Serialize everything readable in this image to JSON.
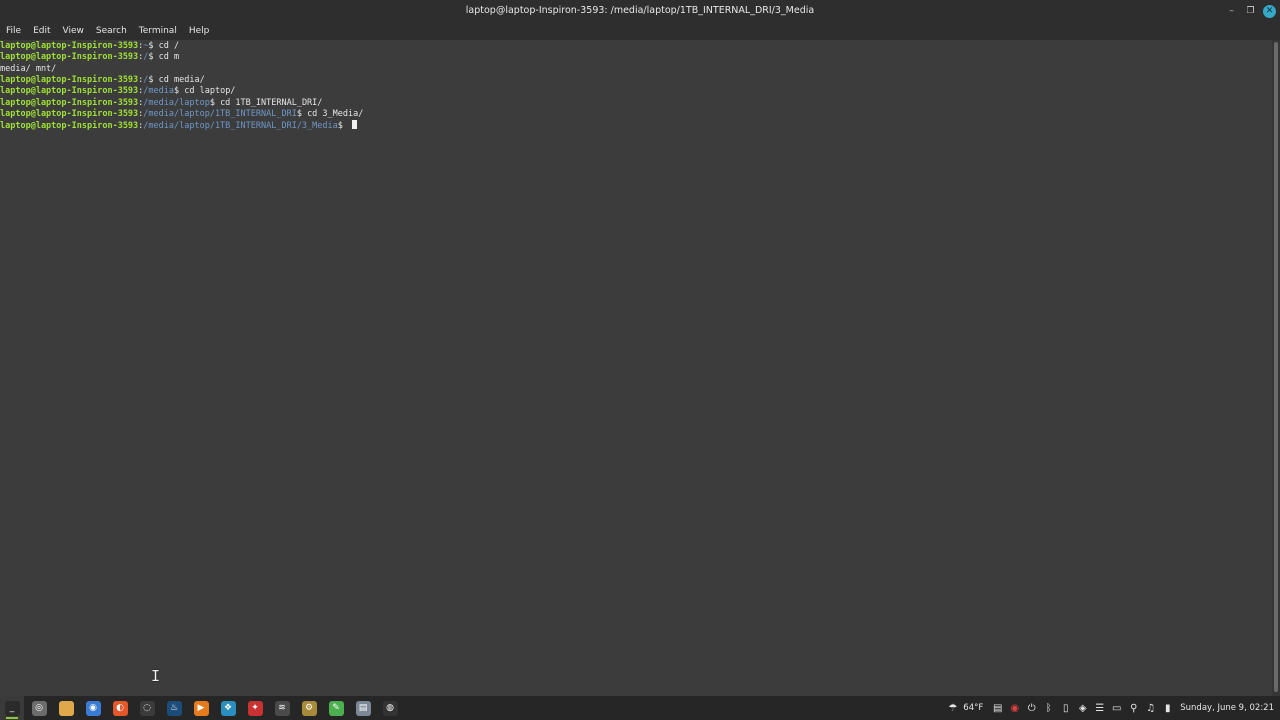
{
  "window": {
    "title": "laptop@laptop-Inspiron-3593: /media/laptop/1TB_INTERNAL_DRI/3_Media"
  },
  "menu": [
    "File",
    "Edit",
    "View",
    "Search",
    "Terminal",
    "Help"
  ],
  "terminal": {
    "lines": [
      {
        "user": "laptop@laptop-Inspiron-3593",
        "sep": ":",
        "path": "~",
        "cmd": "$ cd /"
      },
      {
        "user": "laptop@laptop-Inspiron-3593",
        "sep": ":",
        "path": "/",
        "cmd": "$ cd m"
      },
      {
        "text": "media/ mnt/"
      },
      {
        "user": "laptop@laptop-Inspiron-3593",
        "sep": ":",
        "path": "/",
        "cmd": "$ cd media/"
      },
      {
        "user": "laptop@laptop-Inspiron-3593",
        "sep": ":",
        "path": "/media",
        "cmd": "$ cd laptop/"
      },
      {
        "user": "laptop@laptop-Inspiron-3593",
        "sep": ":",
        "path": "/media/laptop",
        "cmd": "$ cd 1TB_INTERNAL_DRI/"
      },
      {
        "user": "laptop@laptop-Inspiron-3593",
        "sep": ":",
        "path": "/media/laptop/1TB_INTERNAL_DRI",
        "cmd": "$ cd 3_Media/"
      },
      {
        "user": "laptop@laptop-Inspiron-3593",
        "sep": ":",
        "path": "/media/laptop/1TB_INTERNAL_DRI/3_Media",
        "cmd": "$ ",
        "cursor": true
      }
    ]
  },
  "taskbar": {
    "apps": [
      {
        "name": "terminal-app-icon",
        "glyph": "_",
        "color": "#2b2b2b",
        "active": true
      },
      {
        "name": "screenshot-app-icon",
        "glyph": "◎",
        "color": "#6c6c6c",
        "active": false
      },
      {
        "name": "files-app-icon",
        "glyph": "",
        "color": "#e0a84a",
        "active": false
      },
      {
        "name": "chrome-app-icon",
        "glyph": "◉",
        "color": "#3a7bd5",
        "active": false
      },
      {
        "name": "firefox-app-icon",
        "glyph": "◐",
        "color": "#e5572a",
        "active": false
      },
      {
        "name": "obs-app-icon",
        "glyph": "◌",
        "color": "#3b3b3b",
        "active": false
      },
      {
        "name": "steam-app-icon",
        "glyph": "♨",
        "color": "#1c4d7a",
        "active": false
      },
      {
        "name": "media-player-icon",
        "glyph": "▶",
        "color": "#e77a1c",
        "active": false
      },
      {
        "name": "kodi-app-icon",
        "glyph": "❖",
        "color": "#2a8fbf",
        "active": false
      },
      {
        "name": "game-app-icon",
        "glyph": "✦",
        "color": "#c93232",
        "active": false
      },
      {
        "name": "drone-app-icon",
        "glyph": "≋",
        "color": "#4a4a4a",
        "active": false
      },
      {
        "name": "settings-app-icon",
        "glyph": "⚙",
        "color": "#a78a3a",
        "active": false
      },
      {
        "name": "editor-app-icon",
        "glyph": "✎",
        "color": "#4caf50",
        "active": false
      },
      {
        "name": "notes-app-icon",
        "glyph": "▤",
        "color": "#7c8896",
        "active": false
      },
      {
        "name": "mint-app-icon",
        "glyph": "◍",
        "color": "#333333",
        "active": false
      }
    ],
    "tray": {
      "temperature": "64°F",
      "clock": "Sunday, June 9, 02:21"
    }
  }
}
